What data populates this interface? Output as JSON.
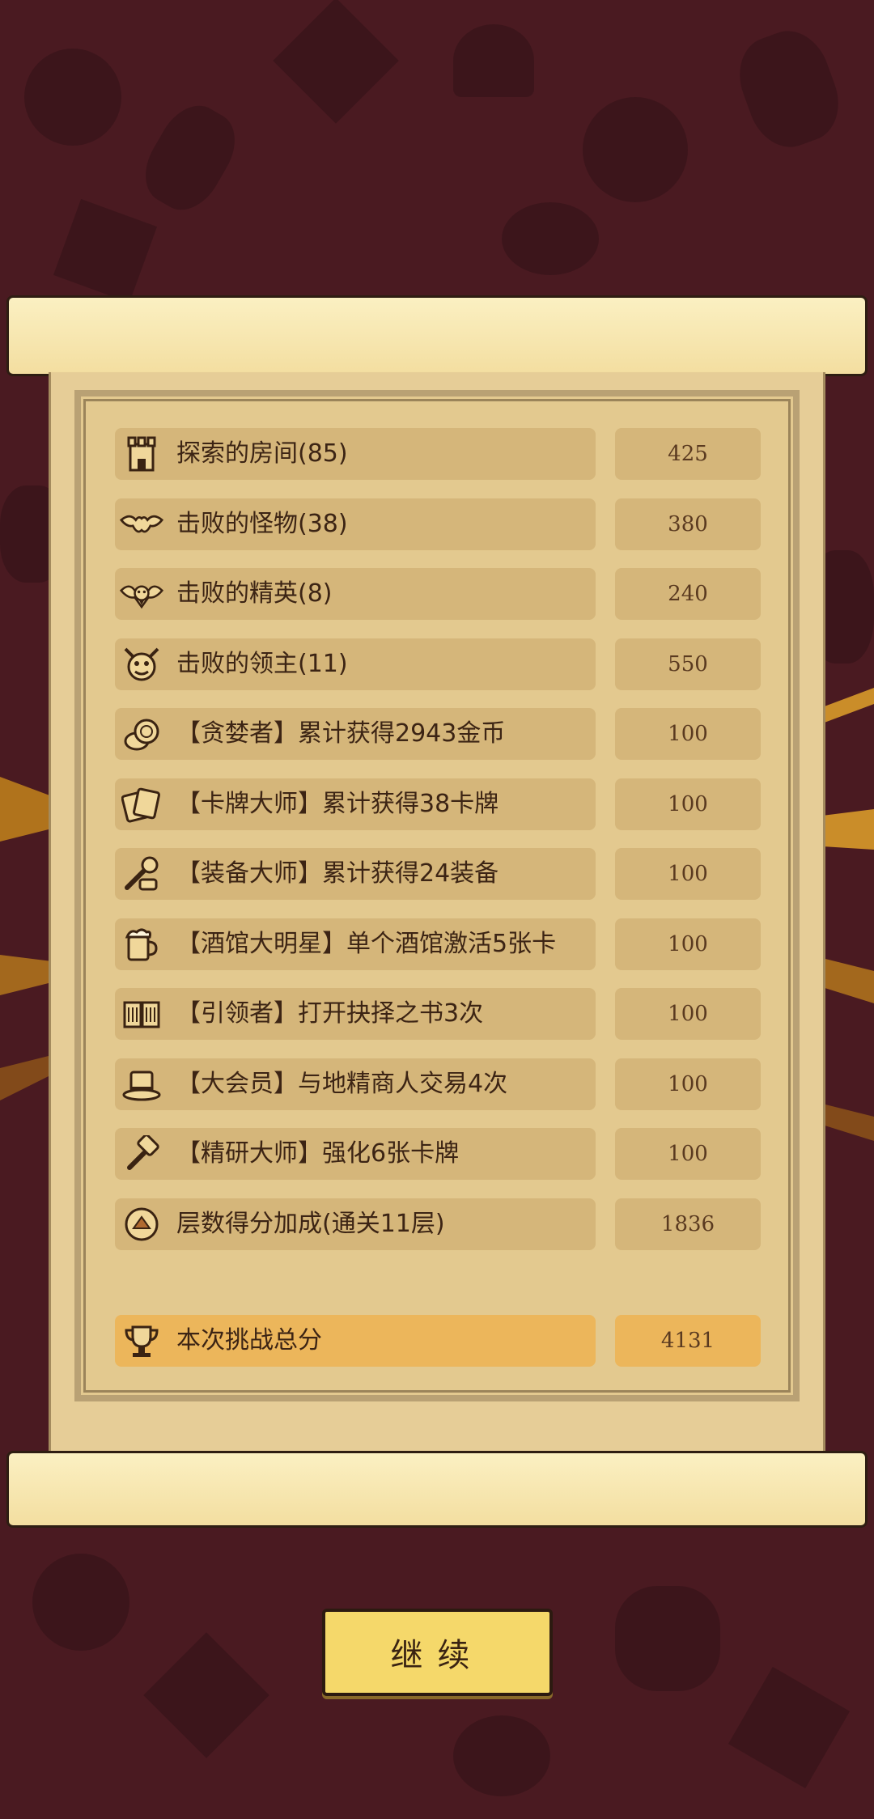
{
  "rows": [
    {
      "icon": "tower-icon",
      "label": "探索的房间(85)",
      "value": "425"
    },
    {
      "icon": "bat-icon",
      "label": "击败的怪物(38)",
      "value": "380"
    },
    {
      "icon": "devil-bat-icon",
      "label": "击败的精英(8)",
      "value": "240"
    },
    {
      "icon": "demon-head-icon",
      "label": "击败的领主(11)",
      "value": "550"
    },
    {
      "icon": "coins-icon",
      "label": "【贪婪者】累计获得2943金币",
      "value": "100"
    },
    {
      "icon": "cards-icon",
      "label": "【卡牌大师】累计获得38卡牌",
      "value": "100"
    },
    {
      "icon": "equipment-icon",
      "label": "【装备大师】累计获得24装备",
      "value": "100"
    },
    {
      "icon": "beer-mug-icon",
      "label": "【酒馆大明星】单个酒馆激活5张卡",
      "value": "100"
    },
    {
      "icon": "book-icon",
      "label": "【引领者】打开抉择之书3次",
      "value": "100"
    },
    {
      "icon": "top-hat-icon",
      "label": "【大会员】与地精商人交易4次",
      "value": "100"
    },
    {
      "icon": "hammer-icon",
      "label": "【精研大师】强化6张卡牌",
      "value": "100"
    },
    {
      "icon": "floor-badge-icon",
      "label": "层数得分加成(通关11层)",
      "value": "1836"
    }
  ],
  "total": {
    "icon": "trophy-icon",
    "label": "本次挑战总分",
    "value": "4131"
  },
  "continue_label": "继续",
  "colors": {
    "background": "#4a1a21",
    "paper": "#e3c98f",
    "row": "#d5b67a",
    "total_row": "#ecb65b",
    "button": "#f5d86a"
  }
}
